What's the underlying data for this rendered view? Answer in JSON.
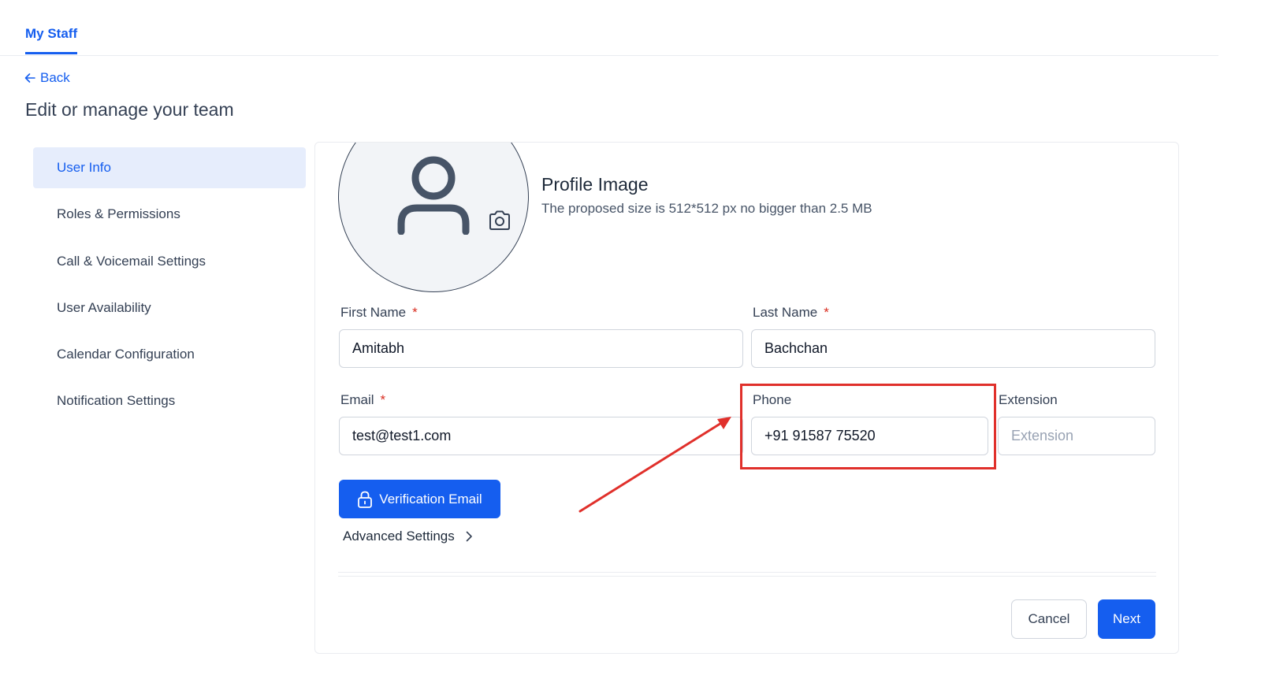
{
  "tabs": {
    "active_label": "My Staff"
  },
  "back": {
    "label": "Back"
  },
  "page": {
    "title": "Edit or manage your team"
  },
  "sidebar": {
    "items": [
      {
        "label": "User Info"
      },
      {
        "label": "Roles & Permissions"
      },
      {
        "label": "Call & Voicemail Settings"
      },
      {
        "label": "User Availability"
      },
      {
        "label": "Calendar Configuration"
      },
      {
        "label": "Notification Settings"
      }
    ],
    "active_index": 0
  },
  "profile": {
    "title": "Profile Image",
    "subtitle": "The proposed size is 512*512 px no bigger than 2.5 MB"
  },
  "form": {
    "first_name": {
      "label": "First Name",
      "required_mark": "*",
      "value": "Amitabh"
    },
    "last_name": {
      "label": "Last Name",
      "required_mark": "*",
      "value": "Bachchan"
    },
    "email": {
      "label": "Email",
      "required_mark": "*",
      "value": "test@test1.com"
    },
    "phone": {
      "label": "Phone",
      "value": "+91 91587 75520"
    },
    "extension": {
      "label": "Extension",
      "value": "",
      "placeholder": "Extension"
    }
  },
  "buttons": {
    "verification_email": "Verification Email",
    "advanced_settings": "Advanced Settings",
    "cancel": "Cancel",
    "next": "Next"
  },
  "icons": {
    "back": "arrow-left-icon",
    "avatar": "user-icon",
    "camera": "camera-icon",
    "lock": "lock-icon",
    "chevron": "chevron-right-icon"
  },
  "colors": {
    "primary": "#155eef",
    "active_bg": "#e6edfc",
    "required": "#d92d20",
    "annotation": "#e0302b"
  }
}
